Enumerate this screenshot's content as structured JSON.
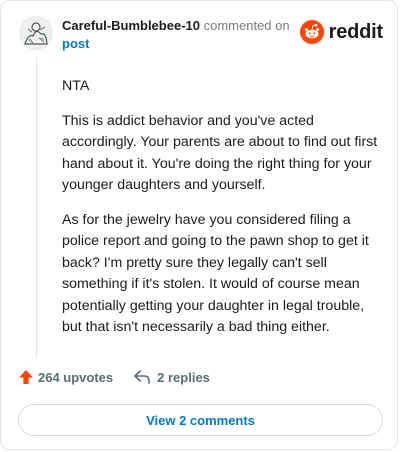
{
  "comment": {
    "username": "Careful-Bumblebee-10",
    "action_text": "commented on",
    "post_link": "post",
    "paragraphs": [
      "NTA",
      "This is addict behavior and you've acted accordingly. Your parents are about to find out first hand about it. You're doing the right thing for your younger daughters and yourself.",
      "As for the jewelry have you considered filing a police report and going to the pawn shop to get it back? I'm pretty sure they legally can't sell something if it's stolen. It would of course mean potentially getting your daughter in legal trouble, but that isn't necessarily a bad thing either."
    ]
  },
  "brand": {
    "logo_text": "reddit",
    "icon": "reddit-snoo-icon",
    "color": "#ff4500"
  },
  "actions": {
    "upvotes_label": "264 upvotes",
    "replies_label": "2 replies",
    "upvote_icon": "upvote-arrow-icon",
    "reply_icon": "reply-arrow-icon",
    "upvote_color": "#ff4500"
  },
  "footer": {
    "view_comments_label": "View 2 comments"
  },
  "colors": {
    "link": "#0079d3",
    "muted": "#576f76",
    "border": "#e5e5e5"
  }
}
